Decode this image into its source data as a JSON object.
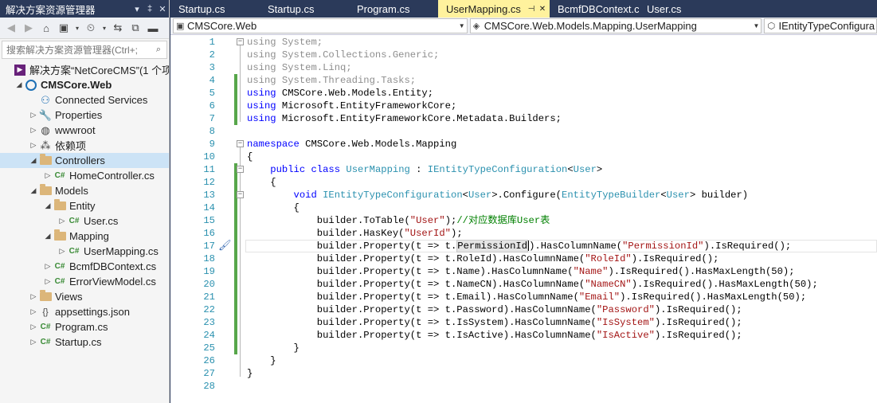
{
  "solution_explorer": {
    "title": "解决方案资源管理器",
    "title_controls": [
      "▾",
      "‡",
      "✕"
    ],
    "search_placeholder": "搜索解决方案资源管理器(Ctrl+;",
    "tree": [
      {
        "label": "解决方案“NetCoreCMS”(1 个项",
        "icon": "vs-solution-icon",
        "expander": "",
        "depth": 0
      },
      {
        "label": "CMSCore.Web",
        "icon": "web-project-icon",
        "expander": "◢",
        "depth": 1,
        "bold": true
      },
      {
        "label": "Connected Services",
        "icon": "connected-services-icon",
        "expander": "",
        "depth": 2
      },
      {
        "label": "Properties",
        "icon": "wrench-icon",
        "expander": "▷",
        "depth": 2
      },
      {
        "label": "wwwroot",
        "icon": "globe-icon",
        "expander": "▷",
        "depth": 2
      },
      {
        "label": "依赖项",
        "icon": "dependencies-icon",
        "expander": "▷",
        "depth": 2
      },
      {
        "label": "Controllers",
        "icon": "folder-icon",
        "expander": "◢",
        "depth": 2,
        "selected": true
      },
      {
        "label": "HomeController.cs",
        "icon": "csharp-file-icon",
        "expander": "▷",
        "depth": 3
      },
      {
        "label": "Models",
        "icon": "folder-icon",
        "expander": "◢",
        "depth": 2
      },
      {
        "label": "Entity",
        "icon": "folder-icon",
        "expander": "◢",
        "depth": 3
      },
      {
        "label": "User.cs",
        "icon": "csharp-file-icon",
        "expander": "▷",
        "depth": 4
      },
      {
        "label": "Mapping",
        "icon": "folder-icon",
        "expander": "◢",
        "depth": 3
      },
      {
        "label": "UserMapping.cs",
        "icon": "csharp-file-icon",
        "expander": "▷",
        "depth": 4
      },
      {
        "label": "BcmfDBContext.cs",
        "icon": "csharp-file-icon",
        "expander": "▷",
        "depth": 3
      },
      {
        "label": "ErrorViewModel.cs",
        "icon": "csharp-file-icon",
        "expander": "▷",
        "depth": 3
      },
      {
        "label": "Views",
        "icon": "folder-icon",
        "expander": "▷",
        "depth": 2
      },
      {
        "label": "appsettings.json",
        "icon": "json-file-icon",
        "expander": "▷",
        "depth": 2
      },
      {
        "label": "Program.cs",
        "icon": "csharp-file-icon",
        "expander": "▷",
        "depth": 2
      },
      {
        "label": "Startup.cs",
        "icon": "csharp-file-icon",
        "expander": "▷",
        "depth": 2
      }
    ]
  },
  "editor": {
    "tabs": [
      {
        "label": "Startup.cs",
        "active": false
      },
      {
        "label": "Startup.cs",
        "active": false
      },
      {
        "label": "Program.cs",
        "active": false
      },
      {
        "label": "UserMapping.cs",
        "active": true
      },
      {
        "label": "BcmfDBContext.cs",
        "active": false
      },
      {
        "label": "User.cs",
        "active": false
      }
    ],
    "tab_pin_glyph": "⊣",
    "tab_close_glyph": "✕",
    "nav": {
      "project": "CMSCore.Web",
      "class": "CMSCore.Web.Models.Mapping.UserMapping",
      "member": "IEntityTypeConfigura"
    },
    "lines": [
      [
        [
          "gray",
          "using System;"
        ]
      ],
      [
        [
          "gray",
          "using System.Collections.Generic;"
        ]
      ],
      [
        [
          "gray",
          "using System.Linq;"
        ]
      ],
      [
        [
          "gray",
          "using System.Threading.Tasks;"
        ]
      ],
      [
        [
          "kw",
          "using"
        ],
        [
          "p",
          " CMSCore.Web.Models.Entity;"
        ]
      ],
      [
        [
          "kw",
          "using"
        ],
        [
          "p",
          " Microsoft.EntityFrameworkCore;"
        ]
      ],
      [
        [
          "kw",
          "using"
        ],
        [
          "p",
          " Microsoft.EntityFrameworkCore.Metadata.Builders;"
        ]
      ],
      [],
      [
        [
          "kw",
          "namespace"
        ],
        [
          "p",
          " CMSCore.Web.Models.Mapping"
        ]
      ],
      [
        [
          "p",
          "{"
        ]
      ],
      [
        [
          "p",
          "    "
        ],
        [
          "kw",
          "public"
        ],
        [
          "p",
          " "
        ],
        [
          "kw",
          "class"
        ],
        [
          "p",
          " "
        ],
        [
          "ty",
          "UserMapping"
        ],
        [
          "p",
          " : "
        ],
        [
          "ty",
          "IEntityTypeConfiguration"
        ],
        [
          "p",
          "<"
        ],
        [
          "ty",
          "User"
        ],
        [
          "p",
          ">"
        ]
      ],
      [
        [
          "p",
          "    {"
        ]
      ],
      [
        [
          "p",
          "        "
        ],
        [
          "kw",
          "void"
        ],
        [
          "p",
          " "
        ],
        [
          "ty",
          "IEntityTypeConfiguration"
        ],
        [
          "p",
          "<"
        ],
        [
          "ty",
          "User"
        ],
        [
          "p",
          ">.Configure("
        ],
        [
          "ty",
          "EntityTypeBuilder"
        ],
        [
          "p",
          "<"
        ],
        [
          "ty",
          "User"
        ],
        [
          "p",
          "> builder)"
        ]
      ],
      [
        [
          "p",
          "        {"
        ]
      ],
      [
        [
          "p",
          "            builder.ToTable("
        ],
        [
          "str",
          "\"User\""
        ],
        [
          "p",
          ");"
        ],
        [
          "cm",
          "//对应数据库User表"
        ]
      ],
      [
        [
          "p",
          "            builder.HasKey("
        ],
        [
          "str",
          "\"UserId\""
        ],
        [
          "p",
          ");"
        ]
      ],
      [
        [
          "p",
          "            builder.Property(t => t."
        ],
        [
          "hl",
          "PermissionId"
        ],
        [
          "caret",
          ""
        ],
        [
          "p",
          ").HasColumnName("
        ],
        [
          "str",
          "\"PermissionId\""
        ],
        [
          "p",
          ").IsRequired();"
        ]
      ],
      [
        [
          "p",
          "            builder.Property(t => t.RoleId).HasColumnName("
        ],
        [
          "str",
          "\"RoleId\""
        ],
        [
          "p",
          ").IsRequired();"
        ]
      ],
      [
        [
          "p",
          "            builder.Property(t => t.Name).HasColumnName("
        ],
        [
          "str",
          "\"Name\""
        ],
        [
          "p",
          ").IsRequired().HasMaxLength(50);"
        ]
      ],
      [
        [
          "p",
          "            builder.Property(t => t.NameCN).HasColumnName("
        ],
        [
          "str",
          "\"NameCN\""
        ],
        [
          "p",
          ").IsRequired().HasMaxLength(50);"
        ]
      ],
      [
        [
          "p",
          "            builder.Property(t => t.Email).HasColumnName("
        ],
        [
          "str",
          "\"Email\""
        ],
        [
          "p",
          ").IsRequired().HasMaxLength(50);"
        ]
      ],
      [
        [
          "p",
          "            builder.Property(t => t.Password).HasColumnName("
        ],
        [
          "str",
          "\"Password\""
        ],
        [
          "p",
          ").IsRequired();"
        ]
      ],
      [
        [
          "p",
          "            builder.Property(t => t.IsSystem).HasColumnName("
        ],
        [
          "str",
          "\"IsSystem\""
        ],
        [
          "p",
          ").IsRequired();"
        ]
      ],
      [
        [
          "p",
          "            builder.Property(t => t.IsActive).HasColumnName("
        ],
        [
          "str",
          "\"IsActive\""
        ],
        [
          "p",
          ").IsRequired();"
        ]
      ],
      [
        [
          "p",
          "        }"
        ]
      ],
      [
        [
          "p",
          "    }"
        ]
      ],
      [
        [
          "p",
          "}"
        ]
      ],
      []
    ],
    "current_line": 17,
    "colors": {
      "keyword": "#0000ff",
      "type": "#2b91af",
      "string": "#a31515",
      "comment": "#008000",
      "unused": "#8e8e8e",
      "line_number": "#2b91af",
      "change_bar": "#57a64a",
      "active_tab": "#fff29d",
      "title_bar": "#2b3a5a"
    }
  }
}
